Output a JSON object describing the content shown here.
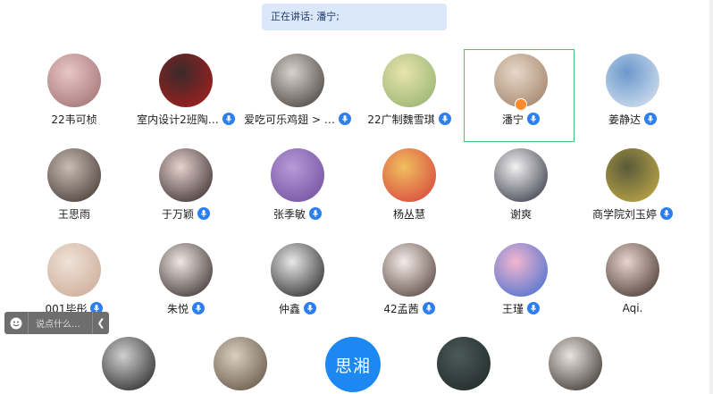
{
  "banner": {
    "text": "正在讲话: 潘宁;"
  },
  "participants": [
    {
      "name": "22韦可桢",
      "mic": false,
      "c1": "#e9c7c7",
      "c2": "#9b6a6a"
    },
    {
      "name": "室内设计2班陶…",
      "mic": true,
      "c1": "#3a2a2a",
      "c2": "#b01e1e"
    },
    {
      "name": "爱吃可乐鸡翅 > …",
      "mic": true,
      "c1": "#d8d2cc",
      "c2": "#3c3532"
    },
    {
      "name": "22广制魏雪琪",
      "mic": true,
      "c1": "#e8e4b0",
      "c2": "#8fae6a"
    },
    {
      "name": "潘宁",
      "mic": true,
      "c1": "#e8d8c8",
      "c2": "#9a7a62"
    },
    {
      "name": "姜静达",
      "mic": true,
      "c1": "#6b98cc",
      "c2": "#dfe8f2"
    },
    {
      "name": "王思雨",
      "mic": false,
      "c1": "#c9bcb4",
      "c2": "#3b2f2a"
    },
    {
      "name": "于万颖",
      "mic": true,
      "c1": "#e6d2cf",
      "c2": "#2b2020"
    },
    {
      "name": "张季敏",
      "mic": true,
      "c1": "#b89ad8",
      "c2": "#6a4a9a"
    },
    {
      "name": "杨丛慧",
      "mic": false,
      "c1": "#f0c060",
      "c2": "#d63a3a"
    },
    {
      "name": "谢爽",
      "mic": false,
      "c1": "#f2f2f2",
      "c2": "#2a2a3a"
    },
    {
      "name": "商学院刘玉婷",
      "mic": true,
      "c1": "#5a5a3a",
      "c2": "#c8b048"
    },
    {
      "name": "001毕彤",
      "mic": true,
      "c1": "#efe2d8",
      "c2": "#c9a690"
    },
    {
      "name": "朱悦",
      "mic": true,
      "c1": "#f0e6e2",
      "c2": "#2a2222"
    },
    {
      "name": "仲鑫",
      "mic": true,
      "c1": "#e8e8e8",
      "c2": "#1a1a1a"
    },
    {
      "name": "42孟茜",
      "mic": true,
      "c1": "#f4ece8",
      "c2": "#4a3630"
    },
    {
      "name": "王瑾",
      "mic": true,
      "c1": "#f2b6cf",
      "c2": "#3a6ad0"
    },
    {
      "name": "Aqi.",
      "mic": false,
      "c1": "#e8d4cc",
      "c2": "#3a2a26"
    }
  ],
  "bottom_row": [
    {
      "c1": "#d0d0d0",
      "c2": "#1a1a1a"
    },
    {
      "c1": "#d8d0c0",
      "c2": "#5a4a3a"
    },
    {
      "text": "思湘"
    },
    {
      "c1": "#4a5a58",
      "c2": "#1e2624"
    },
    {
      "c1": "#eae4de",
      "c2": "#2c2420"
    }
  ],
  "chat": {
    "placeholder": "说点什么...",
    "collapse_icon": "chevron-left-icon",
    "emoji_icon": "smile-icon"
  },
  "colors": {
    "accent": "#2d7ff0",
    "active_border": "#4cc36b",
    "banner_bg": "#dbe7fb"
  }
}
